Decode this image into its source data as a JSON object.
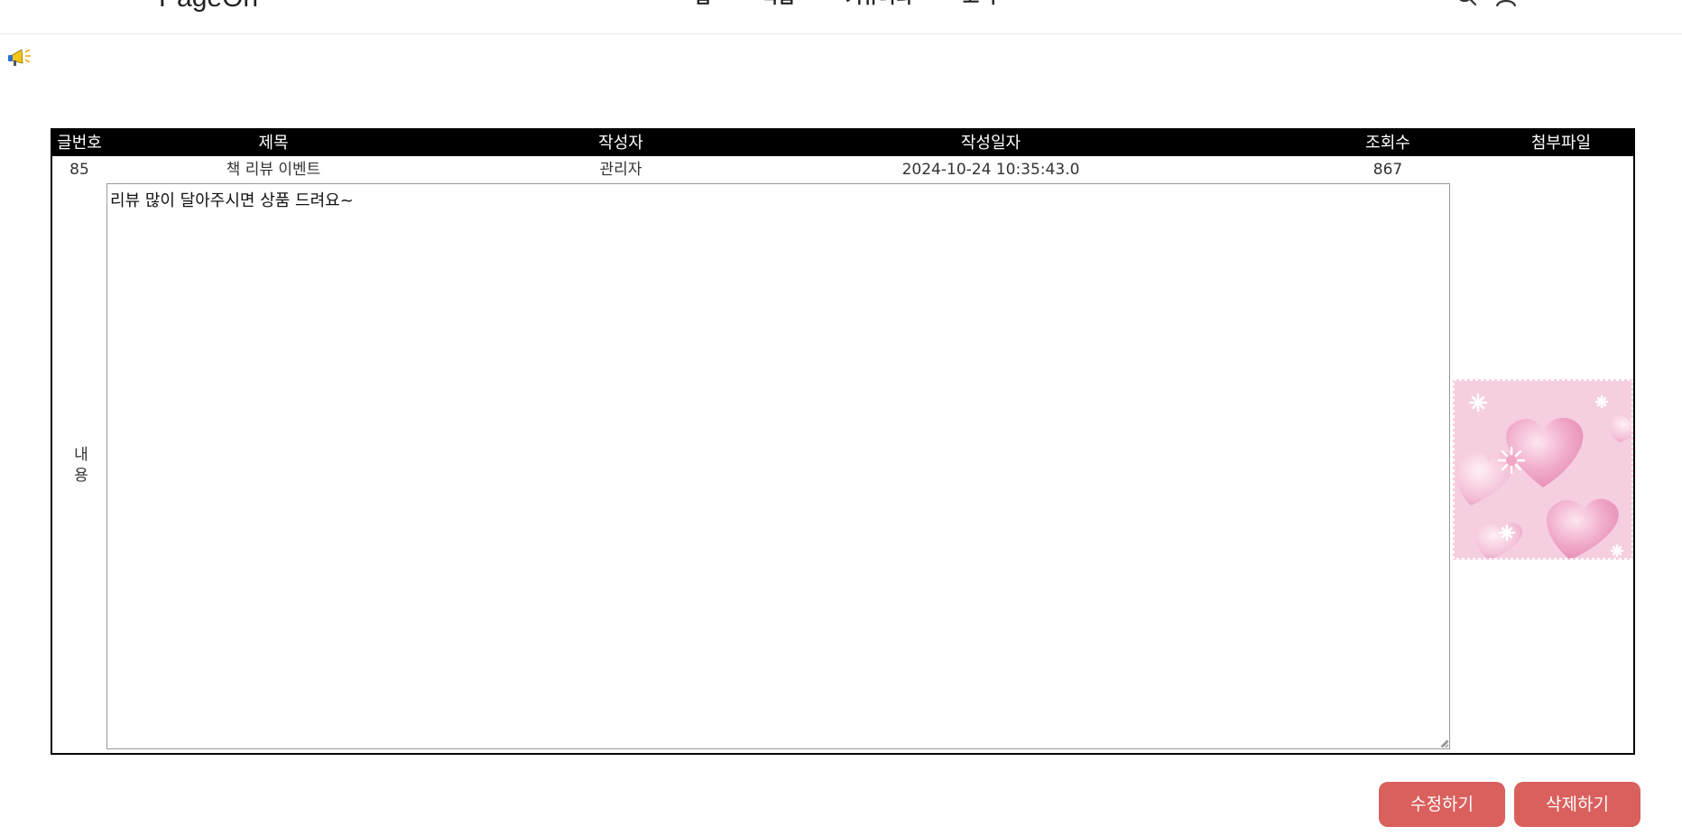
{
  "header": {
    "brand": "PageOn",
    "nav": [
      "홈",
      "작품",
      "커뮤니티",
      "고객"
    ],
    "icons": [
      "search-icon",
      "user-icon"
    ]
  },
  "notice": {
    "icon": "megaphone-icon"
  },
  "board": {
    "columns": [
      "글번호",
      "제목",
      "작성자",
      "작성일자",
      "조회수",
      "첨부파일"
    ],
    "row": {
      "number": "85",
      "title": "책 리뷰 이벤트",
      "author": "관리자",
      "date": "2024-10-24 10:35:43.0",
      "views": "867"
    },
    "content_label": "내용",
    "content_text": "리뷰 많이 달아주시면 상품 드려요~",
    "attachment_icon": "pink-hearts-image"
  },
  "actions": {
    "edit_label": "수정하기",
    "delete_label": "삭제하기"
  },
  "colors": {
    "header_bg": "#000000",
    "button_bg": "#d9605d",
    "attachment_pink": "#f2bfd6"
  }
}
